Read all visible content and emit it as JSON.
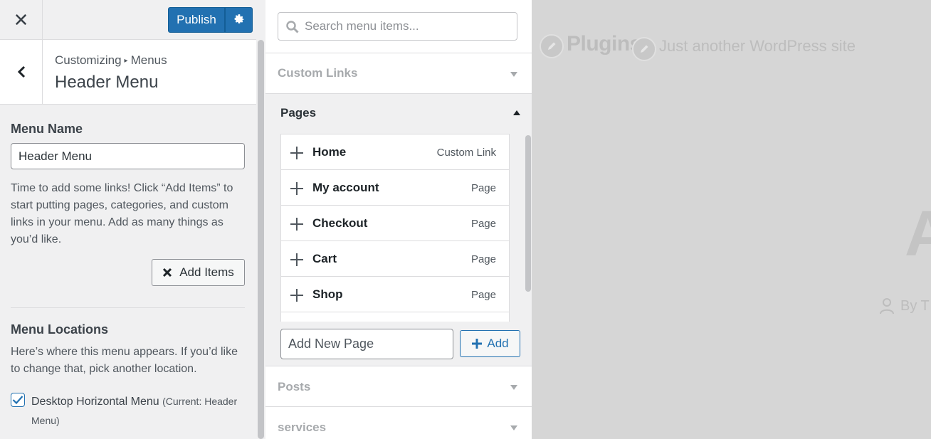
{
  "header": {
    "publish_label": "Publish"
  },
  "panel": {
    "breadcrumb_parent": "Customizing",
    "breadcrumb_separator": "▸",
    "breadcrumb_child": "Menus",
    "title": "Header Menu"
  },
  "menu_name": {
    "label": "Menu Name",
    "value": "Header Menu",
    "help": "Time to add some links! Click “Add Items” to start putting pages, categories, and custom links in your menu. Add as many things as you’d like.",
    "add_items_label": "Add Items"
  },
  "menu_locations": {
    "label": "Menu Locations",
    "help": "Here’s where this menu appears. If you’d like to change that, pick another location.",
    "location_label": "Desktop Horizontal Menu",
    "location_current": "(Current: Header Menu)",
    "location_checked": true
  },
  "items_panel": {
    "search_placeholder": "Search menu items...",
    "sections": {
      "custom_links": "Custom Links",
      "pages": "Pages",
      "posts": "Posts",
      "services": "services"
    },
    "pages": [
      {
        "title": "Home",
        "type": "Custom Link"
      },
      {
        "title": "My account",
        "type": "Page"
      },
      {
        "title": "Checkout",
        "type": "Page"
      },
      {
        "title": "Cart",
        "type": "Page"
      },
      {
        "title": "Shop",
        "type": "Page"
      }
    ],
    "new_page_placeholder": "Add New Page",
    "add_label": "Add"
  },
  "preview": {
    "site_title": "Plugins",
    "tagline": "Just another WordPress site",
    "big_letter": "A",
    "by_line": "By T"
  },
  "colors": {
    "accent": "#2271b1",
    "sidebar_bg": "#f0f0f1",
    "preview_bg": "#d6d6d6"
  }
}
